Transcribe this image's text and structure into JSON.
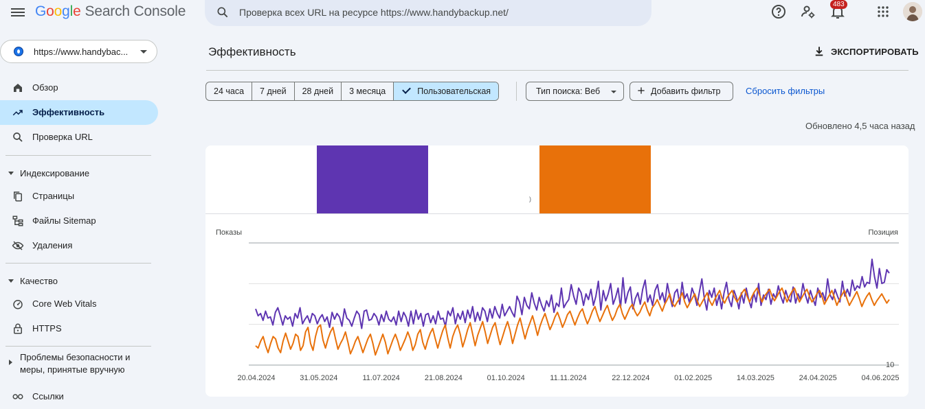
{
  "app": {
    "logo_letters": [
      "G",
      "o",
      "o",
      "g",
      "l",
      "e"
    ],
    "product": "Search Console"
  },
  "search": {
    "placeholder": "Проверка всех URL на ресурсе https://www.handybackup.net/"
  },
  "notifications": {
    "count": "483"
  },
  "property": {
    "url": "https://www.handybac..."
  },
  "sidebar": {
    "items": [
      {
        "label": "Обзор",
        "icon": "home-icon"
      },
      {
        "label": "Эффективность",
        "icon": "trending-up-icon",
        "active": true
      },
      {
        "label": "Проверка URL",
        "icon": "search-icon"
      }
    ],
    "sections": [
      {
        "label": "Индексирование",
        "items": [
          {
            "label": "Страницы",
            "icon": "pages-icon"
          },
          {
            "label": "Файлы Sitemap",
            "icon": "sitemap-icon"
          },
          {
            "label": "Удаления",
            "icon": "removals-icon"
          }
        ]
      },
      {
        "label": "Качество",
        "items": [
          {
            "label": "Core Web Vitals",
            "icon": "gauge-icon"
          },
          {
            "label": "HTTPS",
            "icon": "lock-icon"
          }
        ]
      },
      {
        "label": "Проблемы безопасности и меры, принятые вручную",
        "collapsed": true,
        "line1": "Проблемы безопасности и",
        "line2": "меры, принятые вручную"
      }
    ],
    "links_label": "Ссылки"
  },
  "main": {
    "title": "Эффективность",
    "export_label": "ЭКСПОРТИРОВАТЬ",
    "date_ranges": [
      "24 часа",
      "7 дней",
      "28 дней",
      "3 месяца",
      "Пользовательская"
    ],
    "selected_range": "Пользовательская",
    "search_type": "Тип поиска: Веб",
    "add_filter": "Добавить фильтр",
    "reset_filters": "Сбросить фильтры",
    "updated": "Обновлено 4,5 часа назад",
    "tile_mark": ")"
  },
  "colors": {
    "impressions": "#5e35b1",
    "position": "#e8710a",
    "accent": "#0b57d0",
    "active_bg": "#c2e7ff"
  },
  "chart_data": {
    "type": "line",
    "left_axis_label": "Показы",
    "right_axis_label": "Позиция",
    "right_axis_partial_tick": "10",
    "x_ticks": [
      "20.04.2024",
      "31.05.2024",
      "11.07.2024",
      "21.08.2024",
      "01.10.2024",
      "11.11.2024",
      "22.12.2024",
      "01.02.2025",
      "14.03.2025",
      "24.04.2025",
      "04.06.2025"
    ],
    "x_range": [
      "20.04.2024",
      "07.06.2025"
    ],
    "gridlines": 4,
    "series": [
      {
        "color": "#5e35b1",
        "values": [
          0.44,
          0.38,
          0.4,
          0.34,
          0.42,
          0.36,
          0.37,
          0.3,
          0.41,
          0.45,
          0.38,
          0.3,
          0.38,
          0.35,
          0.37,
          0.29,
          0.4,
          0.36,
          0.45,
          0.31,
          0.35,
          0.38,
          0.32,
          0.4,
          0.38,
          0.31,
          0.36,
          0.39,
          0.33,
          0.37,
          0.28,
          0.41,
          0.35,
          0.4,
          0.37,
          0.29,
          0.44,
          0.36,
          0.34,
          0.29,
          0.36,
          0.42,
          0.39,
          0.27,
          0.42,
          0.43,
          0.34,
          0.35,
          0.4,
          0.37,
          0.3,
          0.39,
          0.33,
          0.42,
          0.35,
          0.33,
          0.37,
          0.3,
          0.42,
          0.33,
          0.41,
          0.37,
          0.29,
          0.42,
          0.31,
          0.43,
          0.35,
          0.4,
          0.29,
          0.39,
          0.4,
          0.32,
          0.38,
          0.31,
          0.42,
          0.35,
          0.36,
          0.29,
          0.42,
          0.38,
          0.45,
          0.31,
          0.4,
          0.35,
          0.42,
          0.32,
          0.43,
          0.36,
          0.46,
          0.33,
          0.41,
          0.34,
          0.45,
          0.42,
          0.33,
          0.44,
          0.36,
          0.46,
          0.4,
          0.36,
          0.48,
          0.38,
          0.42,
          0.46,
          0.41,
          0.37,
          0.55,
          0.5,
          0.39,
          0.54,
          0.47,
          0.44,
          0.58,
          0.49,
          0.43,
          0.54,
          0.47,
          0.42,
          0.51,
          0.46,
          0.56,
          0.41,
          0.49,
          0.46,
          0.62,
          0.45,
          0.49,
          0.52,
          0.65,
          0.55,
          0.48,
          0.62,
          0.58,
          0.47,
          0.57,
          0.52,
          0.61,
          0.47,
          0.55,
          0.68,
          0.43,
          0.6,
          0.51,
          0.57,
          0.66,
          0.48,
          0.54,
          0.62,
          0.45,
          0.71,
          0.49,
          0.58,
          0.63,
          0.44,
          0.53,
          0.58,
          0.48,
          0.61,
          0.69,
          0.5,
          0.56,
          0.47,
          0.6,
          0.65,
          0.52,
          0.58,
          0.49,
          0.66,
          0.55,
          0.46,
          0.58,
          0.61,
          0.48,
          0.67,
          0.53,
          0.57,
          0.49,
          0.62,
          0.56,
          0.47,
          0.59,
          0.7,
          0.53,
          0.43,
          0.6,
          0.54,
          0.62,
          0.47,
          0.56,
          0.44,
          0.58,
          0.67,
          0.52,
          0.46,
          0.6,
          0.54,
          0.44,
          0.58,
          0.49,
          0.62,
          0.52,
          0.45,
          0.58,
          0.5,
          0.66,
          0.47,
          0.56,
          0.52,
          0.61,
          0.48,
          0.57,
          0.53,
          0.64,
          0.55,
          0.49,
          0.6,
          0.53,
          0.5,
          0.63,
          0.49,
          0.57,
          0.52,
          0.66,
          0.56,
          0.49,
          0.6,
          0.53,
          0.47,
          0.62,
          0.54,
          0.58,
          0.51,
          0.7,
          0.56,
          0.52,
          0.61,
          0.55,
          0.5,
          0.68,
          0.55,
          0.61,
          0.55,
          0.69,
          0.6,
          0.64,
          0.62,
          0.72,
          0.63,
          0.67,
          0.66,
          0.87,
          0.72,
          0.62,
          0.79,
          0.66,
          0.67,
          0.78,
          0.75
        ]
      },
      {
        "color": "#e8710a",
        "values": [
          0.12,
          0.1,
          0.16,
          0.2,
          0.12,
          0.06,
          0.14,
          0.2,
          0.18,
          0.1,
          0.06,
          0.16,
          0.23,
          0.16,
          0.09,
          0.14,
          0.22,
          0.2,
          0.08,
          0.12,
          0.24,
          0.28,
          0.14,
          0.08,
          0.2,
          0.28,
          0.3,
          0.17,
          0.1,
          0.18,
          0.24,
          0.28,
          0.18,
          0.09,
          0.14,
          0.18,
          0.24,
          0.15,
          0.05,
          0.1,
          0.16,
          0.2,
          0.13,
          0.06,
          0.12,
          0.18,
          0.22,
          0.14,
          0.04,
          0.1,
          0.16,
          0.22,
          0.15,
          0.05,
          0.11,
          0.17,
          0.22,
          0.16,
          0.08,
          0.13,
          0.18,
          0.24,
          0.18,
          0.08,
          0.13,
          0.22,
          0.26,
          0.15,
          0.09,
          0.17,
          0.23,
          0.27,
          0.18,
          0.1,
          0.18,
          0.25,
          0.3,
          0.19,
          0.1,
          0.2,
          0.26,
          0.3,
          0.22,
          0.11,
          0.18,
          0.26,
          0.32,
          0.22,
          0.12,
          0.21,
          0.27,
          0.33,
          0.24,
          0.14,
          0.21,
          0.28,
          0.32,
          0.22,
          0.13,
          0.2,
          0.27,
          0.33,
          0.25,
          0.14,
          0.22,
          0.3,
          0.36,
          0.27,
          0.18,
          0.26,
          0.32,
          0.38,
          0.3,
          0.21,
          0.29,
          0.35,
          0.4,
          0.33,
          0.26,
          0.31,
          0.37,
          0.41,
          0.35,
          0.28,
          0.33,
          0.39,
          0.42,
          0.36,
          0.3,
          0.36,
          0.41,
          0.44,
          0.37,
          0.31,
          0.36,
          0.42,
          0.46,
          0.39,
          0.33,
          0.38,
          0.43,
          0.47,
          0.4,
          0.34,
          0.38,
          0.44,
          0.48,
          0.4,
          0.35,
          0.4,
          0.45,
          0.48,
          0.42,
          0.38,
          0.41,
          0.46,
          0.5,
          0.43,
          0.38,
          0.45,
          0.48,
          0.52,
          0.47,
          0.42,
          0.48,
          0.52,
          0.57,
          0.49,
          0.46,
          0.5,
          0.53,
          0.58,
          0.5,
          0.45,
          0.49,
          0.53,
          0.57,
          0.51,
          0.46,
          0.5,
          0.54,
          0.58,
          0.51,
          0.47,
          0.52,
          0.56,
          0.6,
          0.53,
          0.49,
          0.54,
          0.57,
          0.6,
          0.54,
          0.5,
          0.54,
          0.58,
          0.61,
          0.55,
          0.5,
          0.55,
          0.59,
          0.62,
          0.56,
          0.5,
          0.55,
          0.58,
          0.61,
          0.55,
          0.51,
          0.55,
          0.59,
          0.62,
          0.56,
          0.5,
          0.55,
          0.59,
          0.62,
          0.56,
          0.5,
          0.54,
          0.58,
          0.61,
          0.55,
          0.5,
          0.53,
          0.57,
          0.6,
          0.55,
          0.48,
          0.52,
          0.56,
          0.6,
          0.54,
          0.47,
          0.52,
          0.56,
          0.6,
          0.53,
          0.47,
          0.51,
          0.55,
          0.59,
          0.53,
          0.46,
          0.51,
          0.55,
          0.58,
          0.52,
          0.47,
          0.51,
          0.54,
          0.57,
          0.53,
          0.49,
          0.52
        ]
      }
    ]
  }
}
